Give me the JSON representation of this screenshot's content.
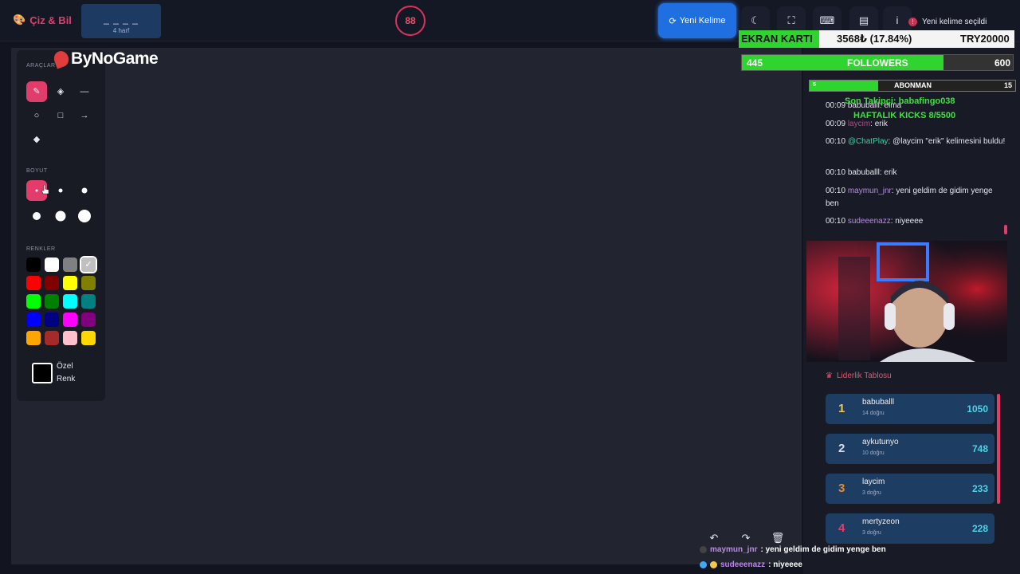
{
  "header": {
    "brand": "Çiz & Bil",
    "word_blanks": "_ _ _ _",
    "word_length": "4 harf",
    "timer": "88",
    "new_word_button": "Yeni Kelime",
    "toast": "Yeni kelime seçildi"
  },
  "toolbar": {
    "tools_section": "ARAÇLAR",
    "size_section": "BOYUT",
    "colors_section": "RENKLER",
    "custom_color_label": "Özel Renk",
    "colors": [
      "#000000",
      "#ffffff",
      "#808080",
      "#c0c0c0",
      "#ff0000",
      "#800000",
      "#ffff00",
      "#808000",
      "#00ff00",
      "#008000",
      "#00ffff",
      "#008080",
      "#0000ff",
      "#000080",
      "#ff00ff",
      "#800080",
      "#ffa500",
      "#a52a2a",
      "#ffc0cb",
      "#ffd700"
    ]
  },
  "overlay": {
    "sponsor": "ByNoGame",
    "ekran_label": "EKRAN KARTI",
    "ekran_value": "3568₺ (17.84%)",
    "ekran_goal": "TRY20000",
    "followers_label": "FOLLOWERS",
    "followers_current": "445",
    "followers_goal": "600",
    "abonman_label": "ABONMAN",
    "abonman_current": "5",
    "abonman_goal": "15",
    "last_follower": "Son Takipçi: babafingo038",
    "weekly_kicks": "HAFTALIK KICKS 8/5500"
  },
  "chat": {
    "messages": [
      {
        "time": "00:09",
        "user": "babuballl",
        "text": ": elma",
        "color": "#e6e8ef"
      },
      {
        "time": "00:09",
        "user": "laycim",
        "text": ": erik",
        "color": "#b44a88"
      },
      {
        "time": "00:10",
        "user": "@ChatPlay",
        "text": ": @laycim \"erik\" kelimesini buldu!",
        "color": "#3fd0a0"
      },
      {
        "time": "00:10",
        "user": "babuballl",
        "text": ": erik",
        "color": "#e6e8ef"
      },
      {
        "time": "00:10",
        "user": "maymun_jnr",
        "text": ": yeni geldim de gidim yenge ben",
        "color": "#b98ae6"
      },
      {
        "time": "00:10",
        "user": "sudeeenazz",
        "text": ": niyeeee",
        "color": "#b98ae6"
      }
    ]
  },
  "leaderboard": {
    "title": "Liderlik Tablosu",
    "rows": [
      {
        "rank": "1",
        "name": "babuballl",
        "correct": "14 doğru",
        "score": "1050",
        "rank_color": "#f2c84b"
      },
      {
        "rank": "2",
        "name": "aykutunyo",
        "correct": "10 doğru",
        "score": "748",
        "rank_color": "#d8dce6"
      },
      {
        "rank": "3",
        "name": "laycim",
        "correct": "3 doğru",
        "score": "233",
        "rank_color": "#e08a3c"
      },
      {
        "rank": "4",
        "name": "mertyzeon",
        "correct": "3 doğru",
        "score": "228",
        "rank_color": "#e23d6a"
      }
    ]
  },
  "stream_chat": [
    {
      "user": "maymun_jnr",
      "text": ": yeni geldim de gidim yenge ben"
    },
    {
      "user": "sudeeenazz",
      "text": ": niyeeee"
    }
  ]
}
